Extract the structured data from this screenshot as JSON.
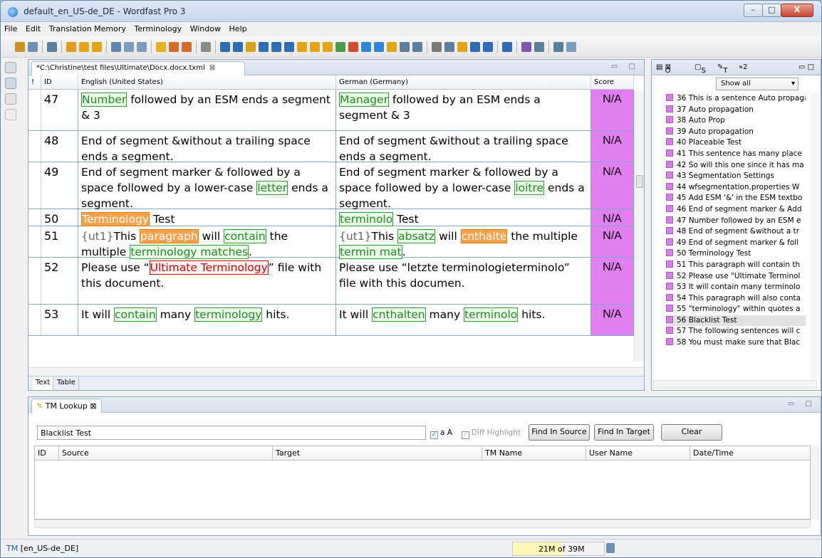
{
  "window": {
    "title": "default_en_US-de_DE - Wordfast Pro 3",
    "controls": {
      "min": "–",
      "max": "□",
      "close": "X"
    }
  },
  "menu": [
    "File",
    "Edit",
    "Translation Memory",
    "Terminology",
    "Window",
    "Help"
  ],
  "toolbar": {
    "icons": [
      "open-icon",
      "save-icon",
      "sync-icon",
      "prev-icon",
      "down-icon",
      "next-icon",
      "edit-icon",
      "table-icon",
      "grid-icon",
      "bookmark-icon",
      "tm-icon",
      "tm2-icon",
      "settings-icon",
      "pilcrow-icon",
      "copy-icon",
      "copy2-icon",
      "down-arrow-icon",
      "up-arrow-icon",
      "updown-icon",
      "propagate-icon",
      "question-icon",
      "propagate2-icon",
      "check-icon",
      "flag-icon",
      "plus-icon",
      "minus-icon",
      "star-icon",
      "x-icon",
      "x2-icon",
      "export-icon",
      "back-icon",
      "flash-icon",
      "prev2-icon",
      "down2-icon",
      "next2-icon",
      "spell-icon",
      "img-icon",
      "img2-icon",
      "note-icon"
    ]
  },
  "editor": {
    "tab": "*C:\\Christine\\test files\\Ultimate\\Docx.docx.txml",
    "headers": {
      "flag": "!",
      "id": "ID",
      "source": "English (United States)",
      "target": "German (Germany)",
      "score": "Score"
    },
    "rows": [
      {
        "id": "47",
        "h": 68,
        "src": [
          {
            "t": "Number",
            "c": "tg"
          },
          {
            "t": " followed by an ESM ends a segment & 3"
          }
        ],
        "tgt": [
          {
            "t": "Manager",
            "c": "tg"
          },
          {
            "t": " followed by an ESM ends a segment & 3"
          }
        ],
        "score": "N/A"
      },
      {
        "id": "48",
        "h": 60,
        "src": [
          {
            "t": "End of segment &without a trailing space ends a segment."
          }
        ],
        "tgt": [
          {
            "t": "End of segment &without a trailing space ends a segment."
          }
        ],
        "score": "N/A"
      },
      {
        "id": "49",
        "h": 78,
        "src": [
          {
            "t": "End of segment marker & followed by a space followed by a lower-case "
          },
          {
            "t": "letter",
            "c": "tg"
          },
          {
            "t": " ends a segment."
          }
        ],
        "tgt": [
          {
            "t": "End of segment marker & followed by a space followed by a lower-case "
          },
          {
            "t": "loitre",
            "c": "tg"
          },
          {
            "t": " ends a segment."
          }
        ],
        "score": "N/A"
      },
      {
        "id": "50",
        "h": 28,
        "src": [
          {
            "t": "Terminology",
            "c": "to"
          },
          {
            "t": " Test"
          }
        ],
        "tgt": [
          {
            "t": "terminolo",
            "c": "tg"
          },
          {
            "t": " Test"
          }
        ],
        "score": "N/A"
      },
      {
        "id": "51",
        "h": 50,
        "src": [
          {
            "t": "{ut1}",
            "c": "tag"
          },
          {
            "t": "This "
          },
          {
            "t": "paragraph",
            "c": "to"
          },
          {
            "t": " will "
          },
          {
            "t": "contain",
            "c": "tg"
          },
          {
            "t": " the multiple "
          },
          {
            "t": "terminology matches",
            "c": "tg"
          },
          {
            "t": "."
          }
        ],
        "tgt": [
          {
            "t": "{ut1}",
            "c": "tag"
          },
          {
            "t": "This "
          },
          {
            "t": "absatz",
            "c": "tg"
          },
          {
            "t": " will "
          },
          {
            "t": "cnthalte",
            "c": "to"
          },
          {
            "t": " the multiple "
          },
          {
            "t": "termin mat",
            "c": "tg"
          },
          {
            "t": "."
          }
        ],
        "score": "N/A"
      },
      {
        "id": "52",
        "h": 72,
        "src": [
          {
            "t": "Please use “"
          },
          {
            "t": "Ultimate Terminology",
            "c": "tr"
          },
          {
            "t": "” file with this document."
          }
        ],
        "tgt": [
          {
            "t": "Please use “letzte terminologieterminolo” file with this documen."
          }
        ],
        "score": "N/A"
      },
      {
        "id": "53",
        "h": 50,
        "src": [
          {
            "t": "It will "
          },
          {
            "t": "contain",
            "c": "tg"
          },
          {
            "t": " many "
          },
          {
            "t": "terminology",
            "c": "tg"
          },
          {
            "t": " hits."
          }
        ],
        "tgt": [
          {
            "t": "It will "
          },
          {
            "t": "cnthalten",
            "c": "tg"
          },
          {
            "t": " many "
          },
          {
            "t": "terminolo",
            "c": "tg"
          },
          {
            "t": " hits."
          }
        ],
        "score": "N/A"
      }
    ],
    "bottom_tabs": [
      "Text",
      "Table"
    ]
  },
  "outline": {
    "tabs": [
      "O",
      "S",
      "T",
      "»2"
    ],
    "filter": "Show all",
    "items": [
      "36 This is a sentence Auto propaga",
      "37 Auto propagation",
      "38 Auto Prop",
      "39 Auto propagation",
      "40 Placeable Test",
      "41 This sentence has many place",
      "42 So will this one since it has ma",
      "43 Segmentation Settings",
      "44 wfsegmentation.properties W",
      "45 Add ESM '&' in the ESM textbo",
      "46 End of segment marker & Add",
      "47 Number followed by an ESM e",
      "48 End of segment &without a tr",
      "49 End of segment marker & foll",
      "50 Terminology Test",
      "51 This paragraph will contain th",
      "52 Please use \"Ultimate Terminol",
      "53 It will contain many terminolo",
      "54 This paragraph will also conta",
      "55 \"terminology\" within quotes a",
      "56 Blacklist Test",
      "57 The following sentences will c",
      "58 You must make sure that Blac"
    ],
    "selected_index": 20
  },
  "tm": {
    "tab": "TM Lookup",
    "search": "Blacklist Test",
    "case_label": "a A",
    "diff_label": "Diff Highlight",
    "btn_source": "Find In Source",
    "btn_target": "Find In Target",
    "btn_clear": "Clear",
    "columns": [
      "ID",
      "Source",
      "Target",
      "TM Name",
      "User Name",
      "Date/Time"
    ]
  },
  "status": {
    "tm": "TM",
    "lang": "[en_US-de_DE]",
    "memory": "21M of 39M",
    "memory_used_fraction": 0.54
  }
}
